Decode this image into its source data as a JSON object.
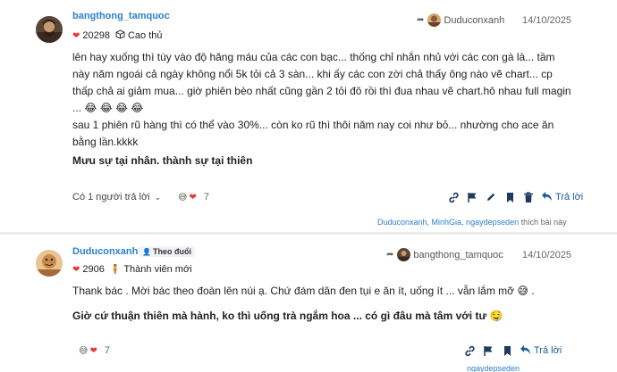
{
  "post1": {
    "username": "bangthong_tamquoc",
    "points": "20298",
    "rank": "Cao thủ",
    "reply_to_user": "Duduconxanh",
    "date": "14/10/2025",
    "content_lines": [
      "lên hay xuống thì tùy vào độ hăng máu của các con bạc... thống chỉ nhắn nhủ với các con gà là... tầm",
      "này năm ngoái cả ngày không nổi 5k tỏi cả 3 sàn... khi ấy các con zời chả thấy ông nào vẽ chart... cp",
      "thấp chả ai giảm mua... giờ phiên bèo nhất cũng gần 2 tỏi đô rồi thì đua nhau vẽ chart.hô nhau full magin",
      "... 😂 😂 😂 😂",
      "sau 1 phiên rũ hàng thì có thể vào 30%... còn ko rũ thì thôi năm nay coi như bỏ... nhường cho ace ăn",
      "bằng lần.kkkk"
    ],
    "bold_line": "Mưu sự tại nhân. thành sự tại thiên",
    "reply_count": "Có 1 người trả lời",
    "reaction_count": "7",
    "reply_label": "Trả lời",
    "likers": {
      "names": "Duduconxanh, MinhGia, ngaydepseden",
      "suffix": "thích bài này"
    }
  },
  "post2": {
    "username": "Duduconxanh",
    "follow_label": "Theo đuổi",
    "points": "2906",
    "rank": "Thành viên mới",
    "reply_to_user": "bangthong_tamquoc",
    "date": "14/10/2025",
    "content_line1": "Thank bác . Mời bác theo đoàn lên núi ạ. Chứ đám dân đen tụi e ăn ít, uống ít ... vẫn lắm mỡ 😅 .",
    "content_line2": "Giờ cứ thuận thiên mà hành, ko thì uống trà ngắm hoa ... có gì đâu mà tâm với tư 🤤",
    "reaction_count": "7",
    "reply_label": "Trả lời",
    "bottom_name": "ngaydepseden"
  },
  "icons": {
    "link": "link-icon",
    "flag": "flag-icon",
    "edit": "pencil-icon",
    "bookmark": "bookmark-icon",
    "delete": "trash-icon",
    "reply": "reply-arrow-icon"
  },
  "colors": {
    "username": "#2a7fcf",
    "reply_button": "#1e5aa0",
    "heart": "#e53935"
  }
}
